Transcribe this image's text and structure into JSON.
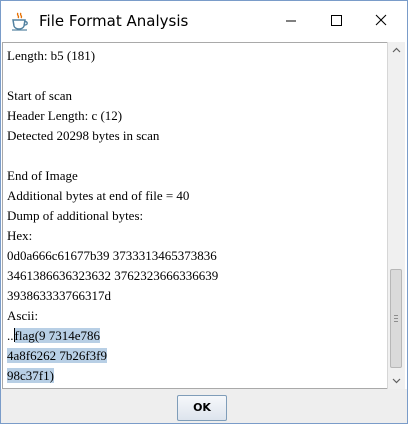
{
  "window": {
    "title": "File Format Analysis",
    "icon": "java-coffee-cup-icon"
  },
  "title_buttons": {
    "minimize_icon": "minimize-icon",
    "maximize_icon": "maximize-icon",
    "close_icon": "close-icon"
  },
  "report": {
    "lines": [
      "Length: b5 (181)",
      "",
      "Start of scan",
      "Header Length: c (12)",
      "Detected 20298 bytes in scan",
      "",
      "End of Image",
      "Additional bytes at end of file = 40",
      "Dump of additional bytes:",
      "Hex:",
      "0d0a666c61677b39 3733313465373836",
      "3461386636323632 3762323666336639",
      "393863333766317d",
      "Ascii:"
    ],
    "ascii_prefix": "..",
    "ascii_selected_lines": [
      "flag(9 7314e786",
      "4a8f6262 7b26f3f9",
      "98c37f1)"
    ]
  },
  "scrollbar": {
    "position": 0.95
  },
  "footer": {
    "ok_label": "OK"
  },
  "colors": {
    "selection": "#b8cfe5",
    "window_border": "#7a9cc9",
    "footer_bg": "#eeeeee"
  }
}
